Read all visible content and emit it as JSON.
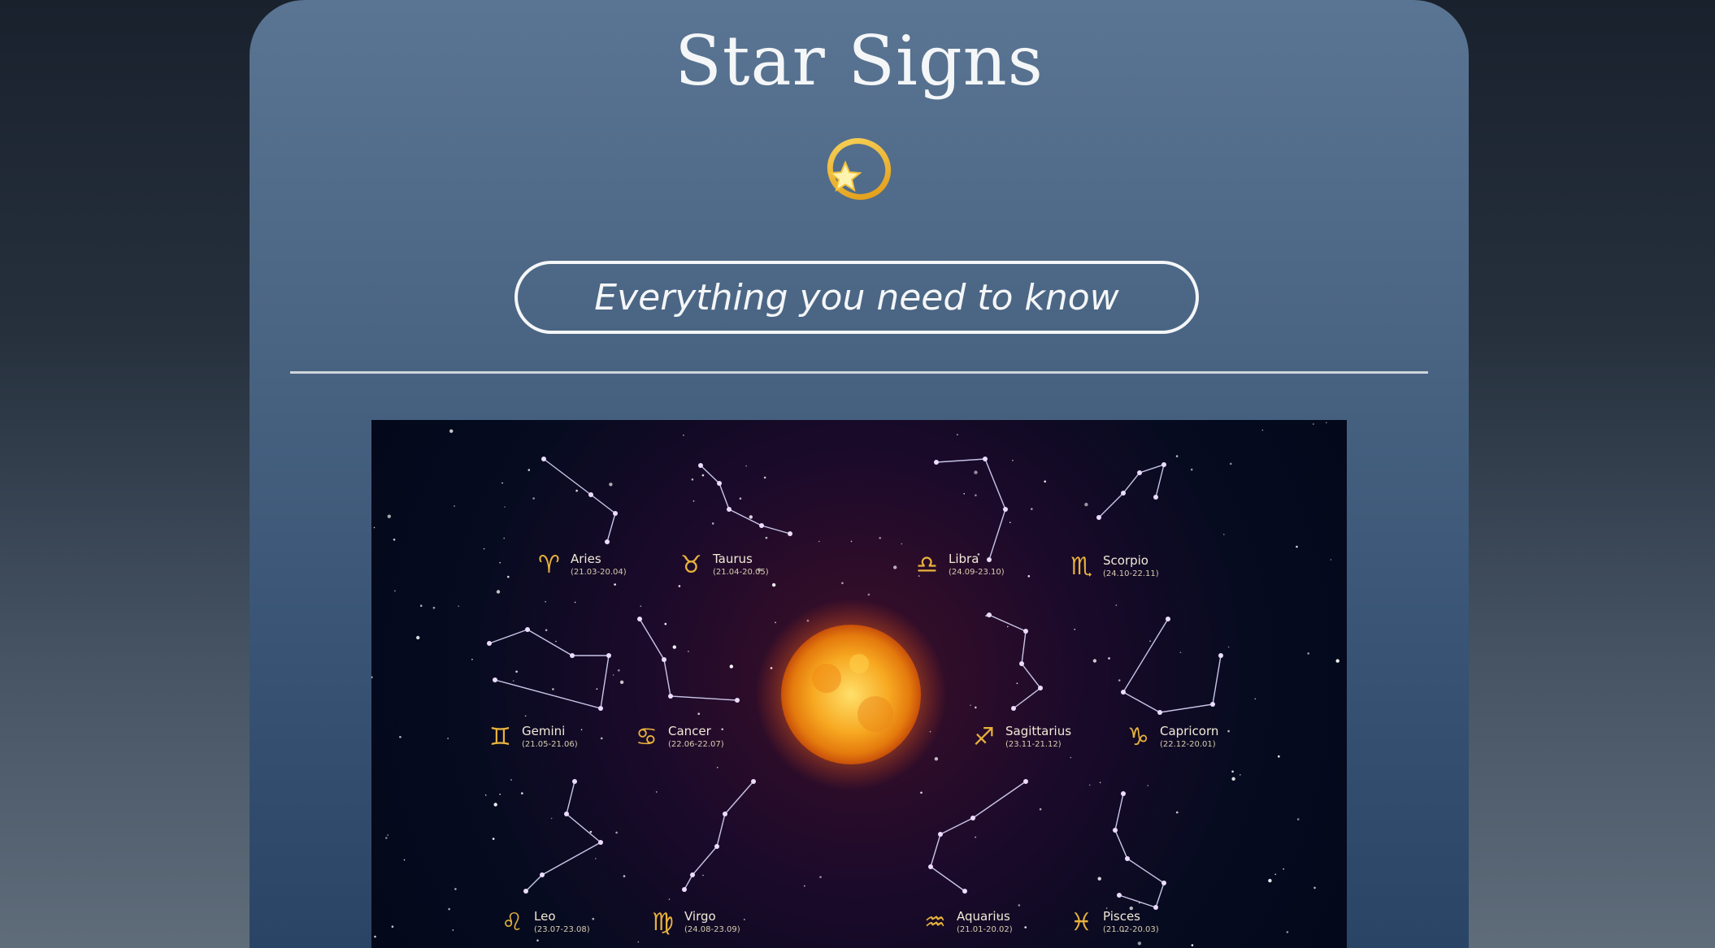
{
  "page": {
    "title": "Star Signs",
    "tagline": "Everything you need to know"
  },
  "icons": {
    "header": "shooting-star-icon"
  },
  "colors": {
    "card_top": "#5a7593",
    "card_bottom": "#2a4466",
    "text": "#f4f6f8",
    "glyph_gold": "#e8b23c",
    "sun": "#f5a718"
  },
  "signs": [
    {
      "name": "Aries",
      "dates": "(21.03-20.04)",
      "glyph": "♈"
    },
    {
      "name": "Taurus",
      "dates": "(21.04-20.05)",
      "glyph": "♉"
    },
    {
      "name": "Libra",
      "dates": "(24.09-23.10)",
      "glyph": "♎"
    },
    {
      "name": "Scorpio",
      "dates": "(24.10-22.11)",
      "glyph": "♏"
    },
    {
      "name": "Gemini",
      "dates": "(21.05-21.06)",
      "glyph": "♊"
    },
    {
      "name": "Cancer",
      "dates": "(22.06-22.07)",
      "glyph": "♋"
    },
    {
      "name": "Sagittarius",
      "dates": "(23.11-21.12)",
      "glyph": "♐"
    },
    {
      "name": "Capricorn",
      "dates": "(22.12-20.01)",
      "glyph": "♑"
    },
    {
      "name": "Leo",
      "dates": "(23.07-23.08)",
      "glyph": "♌"
    },
    {
      "name": "Virgo",
      "dates": "(24.08-23.09)",
      "glyph": "♍"
    },
    {
      "name": "Aquarius",
      "dates": "(21.01-20.02)",
      "glyph": "♒"
    },
    {
      "name": "Pisces",
      "dates": "(21.02-20.03)",
      "glyph": "♓"
    }
  ]
}
